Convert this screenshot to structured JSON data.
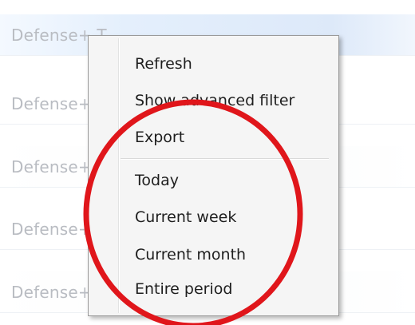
{
  "table": {
    "rows": [
      {
        "text": "Defense+ T",
        "selected": true
      },
      {
        "text": "Defense+",
        "selected": false
      },
      {
        "text": "Defense+",
        "selected": false
      },
      {
        "text": "Defense+",
        "selected": false
      },
      {
        "text": "Defense+",
        "selected": false
      }
    ]
  },
  "context_menu": {
    "group_actions": [
      "Refresh",
      "Show advanced filter",
      "Export"
    ],
    "group_periods": [
      "Today",
      "Current week",
      "Current month",
      "Entire period"
    ]
  },
  "annotation": {
    "shape": "ellipse",
    "color": "#e0161b"
  }
}
